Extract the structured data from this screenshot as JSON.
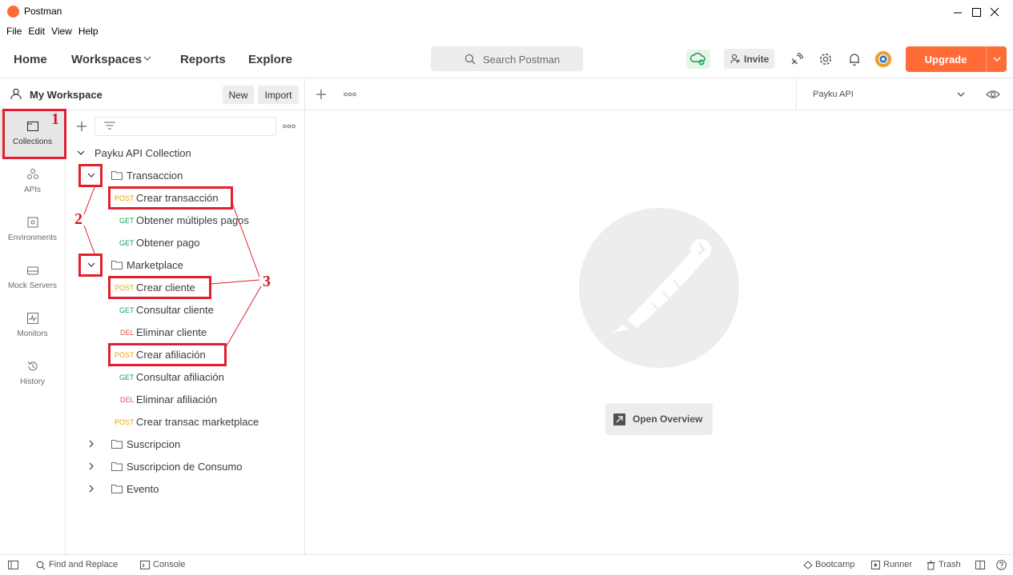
{
  "window": {
    "title": "Postman"
  },
  "menu": [
    "File",
    "Edit",
    "View",
    "Help"
  ],
  "header": {
    "nav": {
      "home": "Home",
      "workspaces": "Workspaces",
      "reports": "Reports",
      "explore": "Explore"
    },
    "search_placeholder": "Search Postman",
    "invite": "Invite",
    "upgrade": "Upgrade"
  },
  "workspace": {
    "name": "My Workspace",
    "new": "New",
    "import": "Import"
  },
  "rail": {
    "collections": "Collections",
    "apis": "APIs",
    "environments": "Environments",
    "mock_servers": "Mock Servers",
    "monitors": "Monitors",
    "history": "History"
  },
  "tree": {
    "collection": "Payku API Collection",
    "folders": {
      "transaccion": "Transaccion",
      "marketplace": "Marketplace",
      "suscripcion": "Suscripcion",
      "suscripcion_consumo": "Suscripcion de Consumo",
      "evento": "Evento"
    },
    "requests": [
      {
        "method": "POST",
        "name": "Crear transacción"
      },
      {
        "method": "GET",
        "name": "Obtener múltiples pagos"
      },
      {
        "method": "GET",
        "name": "Obtener pago"
      },
      {
        "method": "POST",
        "name": "Crear cliente"
      },
      {
        "method": "GET",
        "name": "Consultar cliente"
      },
      {
        "method": "DEL",
        "name": "Eliminar cliente"
      },
      {
        "method": "POST",
        "name": "Crear afiliación"
      },
      {
        "method": "GET",
        "name": "Consultar afiliación"
      },
      {
        "method": "DEL",
        "name": "Eliminar afiliación"
      },
      {
        "method": "POST",
        "name": "Crear transac marketplace"
      }
    ]
  },
  "annotations": {
    "one": "1",
    "two": "2",
    "three": "3"
  },
  "main": {
    "environment": "Payku API",
    "open_overview": "Open Overview"
  },
  "statusbar": {
    "find_replace": "Find and Replace",
    "console": "Console",
    "bootcamp": "Bootcamp",
    "runner": "Runner",
    "trash": "Trash"
  },
  "colors": {
    "accent": "#ff6c37",
    "annotation": "#e0202f",
    "post": "#e8a900",
    "get": "#10a955",
    "del": "#e05353"
  },
  "icons": [
    "search-icon",
    "cloud-sync-icon",
    "satellite-icon",
    "gear-icon",
    "bell-icon",
    "avatar",
    "eye-icon",
    "chevron-down-icon",
    "folder-icon",
    "plus-icon",
    "filter-icon",
    "more-icon"
  ]
}
